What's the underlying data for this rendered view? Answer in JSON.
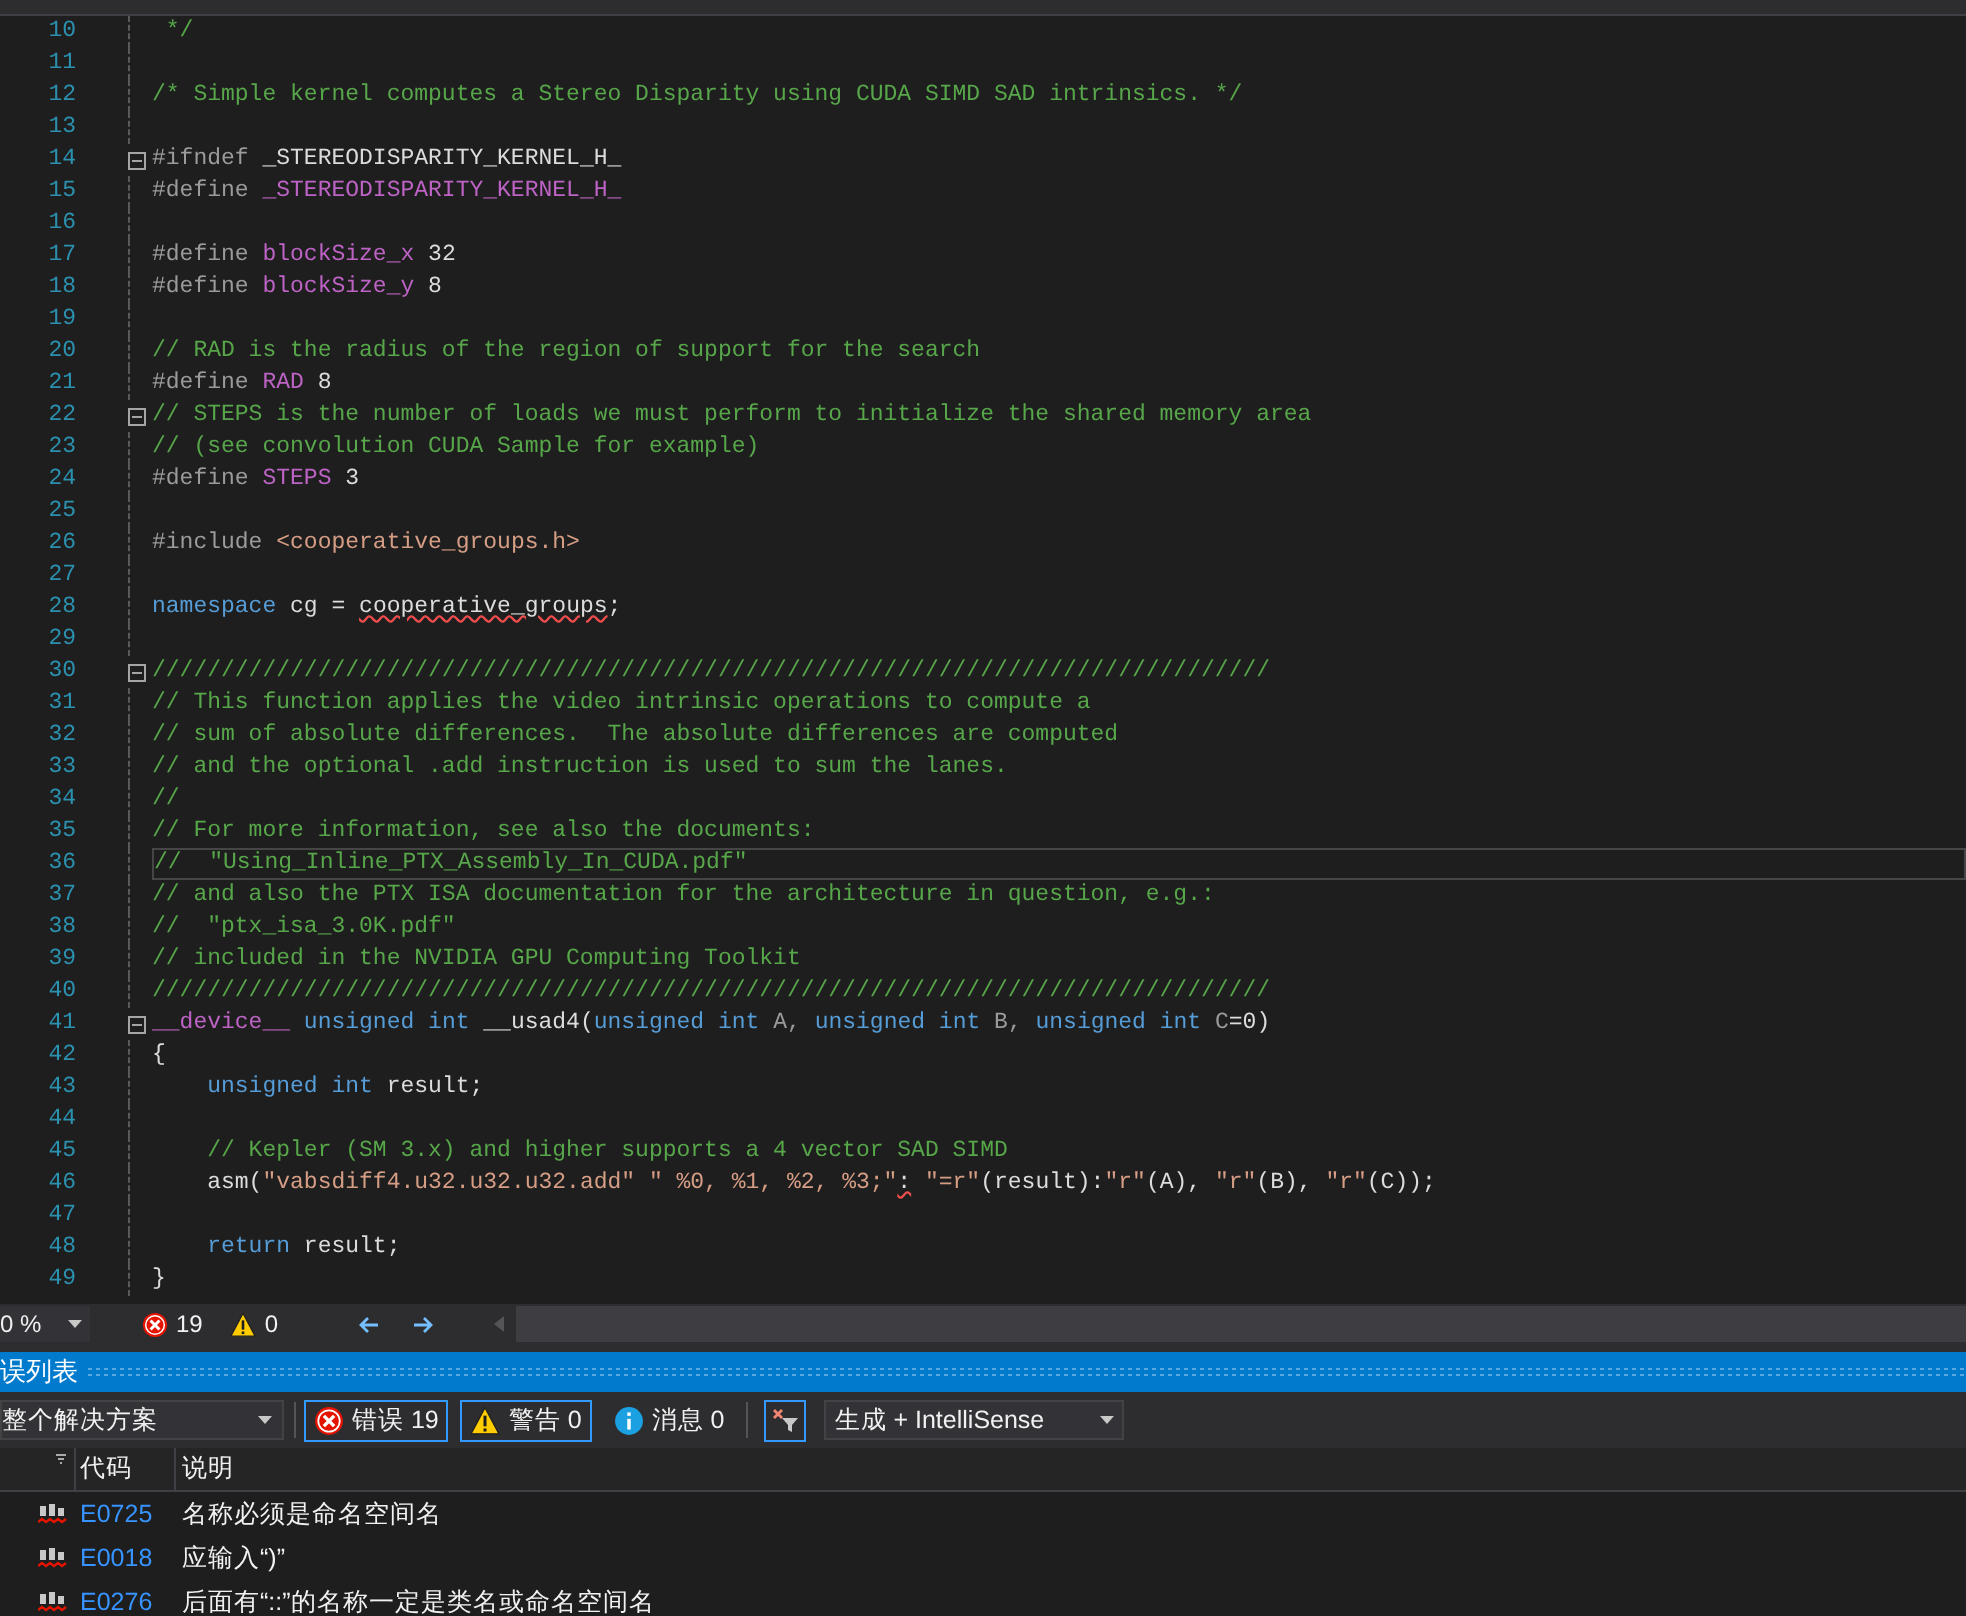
{
  "editor": {
    "lines": [
      {
        "number": "10",
        "fold": false,
        "current": false,
        "tokens": [
          {
            "text": " */",
            "kind": "comment"
          }
        ]
      },
      {
        "number": "11",
        "fold": false,
        "current": false
      },
      {
        "number": "12",
        "fold": false,
        "current": false,
        "tokens": [
          {
            "text": "/* Simple kernel computes a Stereo Disparity using CUDA SIMD SAD intrinsics. */",
            "kind": "comment"
          }
        ]
      },
      {
        "number": "13",
        "fold": false,
        "current": false
      },
      {
        "number": "14",
        "fold": true,
        "current": false,
        "tokens": [
          {
            "text": "#ifndef",
            "kind": "preproc"
          },
          {
            "text": " _STEREODISPARITY_KERNEL_H_",
            "kind": "plain"
          }
        ]
      },
      {
        "number": "15",
        "fold": false,
        "current": false,
        "tokens": [
          {
            "text": "#define",
            "kind": "preproc"
          },
          {
            "text": " _STEREODISPARITY_KERNEL_H_",
            "kind": "macro"
          }
        ]
      },
      {
        "number": "16",
        "fold": false,
        "current": false
      },
      {
        "number": "17",
        "fold": false,
        "current": false,
        "tokens": [
          {
            "text": "#define",
            "kind": "preproc"
          },
          {
            "text": " blockSize_x",
            "kind": "macro"
          },
          {
            "text": " 32",
            "kind": "plain"
          }
        ]
      },
      {
        "number": "18",
        "fold": false,
        "current": false,
        "tokens": [
          {
            "text": "#define",
            "kind": "preproc"
          },
          {
            "text": " blockSize_y",
            "kind": "macro"
          },
          {
            "text": " 8",
            "kind": "plain"
          }
        ]
      },
      {
        "number": "19",
        "fold": false,
        "current": false
      },
      {
        "number": "20",
        "fold": false,
        "current": false,
        "tokens": [
          {
            "text": "// RAD is the radius of the region of support for the search",
            "kind": "comment"
          }
        ]
      },
      {
        "number": "21",
        "fold": false,
        "current": false,
        "tokens": [
          {
            "text": "#define",
            "kind": "preproc"
          },
          {
            "text": " RAD",
            "kind": "macro"
          },
          {
            "text": " 8",
            "kind": "plain"
          }
        ]
      },
      {
        "number": "22",
        "fold": true,
        "current": false,
        "tokens": [
          {
            "text": "// STEPS is the number of loads we must perform to initialize the shared memory area",
            "kind": "comment"
          }
        ]
      },
      {
        "number": "23",
        "fold": false,
        "current": false,
        "tokens": [
          {
            "text": "// (see convolution CUDA Sample for example)",
            "kind": "comment"
          }
        ]
      },
      {
        "number": "24",
        "fold": false,
        "current": false,
        "tokens": [
          {
            "text": "#define",
            "kind": "preproc"
          },
          {
            "text": " STEPS",
            "kind": "macro"
          },
          {
            "text": " 3",
            "kind": "plain"
          }
        ]
      },
      {
        "number": "25",
        "fold": false,
        "current": false
      },
      {
        "number": "26",
        "fold": false,
        "current": false,
        "tokens": [
          {
            "text": "#include",
            "kind": "preproc"
          },
          {
            "text": " <cooperative_groups.h>",
            "kind": "string"
          }
        ]
      },
      {
        "number": "27",
        "fold": false,
        "current": false
      },
      {
        "number": "28",
        "fold": false,
        "current": false,
        "tokens": [
          {
            "text": "namespace",
            "kind": "keyword"
          },
          {
            "text": " cg = ",
            "kind": "plain"
          },
          {
            "text": "cooperative_groups",
            "kind": "error"
          },
          {
            "text": ";",
            "kind": "plain"
          }
        ]
      },
      {
        "number": "29",
        "fold": false,
        "current": false
      },
      {
        "number": "30",
        "fold": true,
        "current": false,
        "tokens": [
          {
            "text": "/////////////////////////////////////////////////////////////////////////////////",
            "kind": "comment"
          }
        ]
      },
      {
        "number": "31",
        "fold": false,
        "current": false,
        "tokens": [
          {
            "text": "// This function applies the video intrinsic operations to compute a",
            "kind": "comment"
          }
        ]
      },
      {
        "number": "32",
        "fold": false,
        "current": false,
        "tokens": [
          {
            "text": "// sum of absolute differences.  The absolute differences are computed",
            "kind": "comment"
          }
        ]
      },
      {
        "number": "33",
        "fold": false,
        "current": false,
        "tokens": [
          {
            "text": "// and the optional .add instruction is used to sum the lanes.",
            "kind": "comment"
          }
        ]
      },
      {
        "number": "34",
        "fold": false,
        "current": false,
        "tokens": [
          {
            "text": "//",
            "kind": "comment"
          }
        ]
      },
      {
        "number": "35",
        "fold": false,
        "current": false,
        "tokens": [
          {
            "text": "// For more information, see also the documents:",
            "kind": "comment"
          }
        ]
      },
      {
        "number": "36",
        "fold": false,
        "current": true,
        "tokens": [
          {
            "text": "//  \"Using_Inline_PTX_Assembly_In_CUDA.pdf\"",
            "kind": "comment"
          }
        ]
      },
      {
        "number": "37",
        "fold": false,
        "current": false,
        "tokens": [
          {
            "text": "// and also the PTX ISA documentation for the architecture in question, e.g.:",
            "kind": "comment"
          }
        ]
      },
      {
        "number": "38",
        "fold": false,
        "current": false,
        "tokens": [
          {
            "text": "//  \"ptx_isa_3.0K.pdf\"",
            "kind": "comment"
          }
        ]
      },
      {
        "number": "39",
        "fold": false,
        "current": false,
        "tokens": [
          {
            "text": "// included in the NVIDIA GPU Computing Toolkit",
            "kind": "comment"
          }
        ]
      },
      {
        "number": "40",
        "fold": false,
        "current": false,
        "tokens": [
          {
            "text": "/////////////////////////////////////////////////////////////////////////////////",
            "kind": "comment"
          }
        ]
      },
      {
        "number": "41",
        "fold": true,
        "current": false,
        "tokens": [
          {
            "text": "__device__",
            "kind": "macro"
          },
          {
            "text": " unsigned",
            "kind": "keyword"
          },
          {
            "text": " int",
            "kind": "keyword"
          },
          {
            "text": " __usad4(",
            "kind": "plain"
          },
          {
            "text": "unsigned",
            "kind": "keyword"
          },
          {
            "text": " int",
            "kind": "keyword"
          },
          {
            "text": " A, ",
            "kind": "param"
          },
          {
            "text": "unsigned",
            "kind": "keyword"
          },
          {
            "text": " int",
            "kind": "keyword"
          },
          {
            "text": " B, ",
            "kind": "param"
          },
          {
            "text": "unsigned",
            "kind": "keyword"
          },
          {
            "text": " int",
            "kind": "keyword"
          },
          {
            "text": " C",
            "kind": "param"
          },
          {
            "text": "=0)",
            "kind": "plain"
          }
        ]
      },
      {
        "number": "42",
        "fold": false,
        "current": false,
        "tokens": [
          {
            "text": "{",
            "kind": "plain"
          }
        ]
      },
      {
        "number": "43",
        "fold": false,
        "current": false,
        "tokens": [
          {
            "text": "    unsigned",
            "kind": "keyword"
          },
          {
            "text": " int",
            "kind": "keyword"
          },
          {
            "text": " result;",
            "kind": "plain"
          }
        ]
      },
      {
        "number": "44",
        "fold": false,
        "current": false
      },
      {
        "number": "45",
        "fold": false,
        "current": false,
        "tokens": [
          {
            "text": "    // Kepler (SM 3.x) and higher supports a 4 vector SAD SIMD",
            "kind": "comment"
          }
        ]
      },
      {
        "number": "46",
        "fold": false,
        "current": false,
        "tokens": [
          {
            "text": "    asm(",
            "kind": "plain"
          },
          {
            "text": "\"vabsdiff4.u32.u32.u32.add\" \" %0, %1, %2, %3;\"",
            "kind": "string"
          },
          {
            "text": ":",
            "kind": "error"
          },
          {
            "text": " \"=r\"",
            "kind": "string"
          },
          {
            "text": "(result):",
            "kind": "plain"
          },
          {
            "text": "\"r\"",
            "kind": "string"
          },
          {
            "text": "(A), ",
            "kind": "plain"
          },
          {
            "text": "\"r\"",
            "kind": "string"
          },
          {
            "text": "(B), ",
            "kind": "plain"
          },
          {
            "text": "\"r\"",
            "kind": "string"
          },
          {
            "text": "(C));",
            "kind": "plain"
          }
        ]
      },
      {
        "number": "47",
        "fold": false,
        "current": false
      },
      {
        "number": "48",
        "fold": false,
        "current": false,
        "tokens": [
          {
            "text": "    return",
            "kind": "keyword"
          },
          {
            "text": " result;",
            "kind": "plain"
          }
        ]
      },
      {
        "number": "49",
        "fold": false,
        "current": false,
        "tokens": [
          {
            "text": "}",
            "kind": "plain"
          }
        ]
      }
    ],
    "status": {
      "zoom": "0 %",
      "errors": "19",
      "warnings": "0"
    }
  },
  "error_list": {
    "title": "误列表",
    "scope": "整个解决方案",
    "filters": [
      {
        "kind": "error",
        "label": "错误 19",
        "selected": true
      },
      {
        "kind": "warning",
        "label": "警告 0",
        "selected": true
      },
      {
        "kind": "info",
        "label": "消息 0",
        "selected": false
      }
    ],
    "source": "生成 + IntelliSense",
    "columns": [
      "代码",
      "说明"
    ],
    "rows": [
      {
        "code": "E0725",
        "description": "名称必须是命名空间名"
      },
      {
        "code": "E0018",
        "description": "应输入“)”"
      },
      {
        "code": "E0276",
        "description": "后面有“::”的名称一定是类名或命名空间名"
      }
    ]
  }
}
